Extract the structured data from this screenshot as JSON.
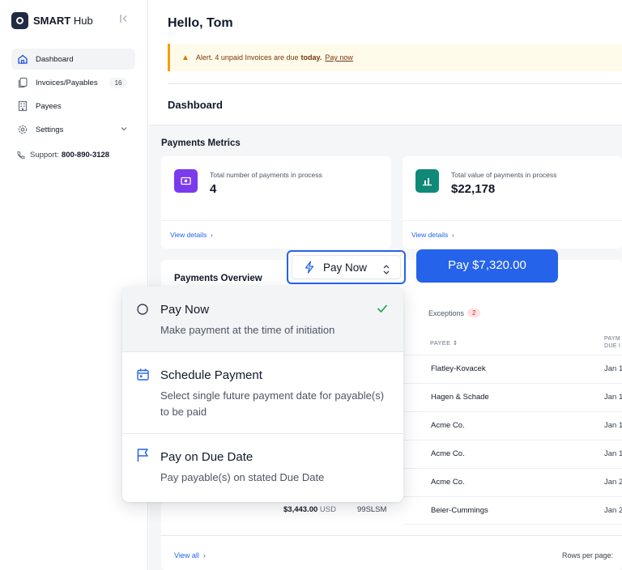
{
  "sidebar": {
    "brand_bold": "SMART",
    "brand_rest": "Hub",
    "items": [
      {
        "label": "Dashboard"
      },
      {
        "label": "Invoices/Payables",
        "badge": "16"
      },
      {
        "label": "Payees"
      },
      {
        "label": "Settings"
      }
    ],
    "support_label": "Support:",
    "support_phone": "800-890-3128"
  },
  "header": {
    "greeting": "Hello, Tom",
    "alert_text": "Alert. 4 unpaid Invoices are due",
    "alert_bold": "today.",
    "alert_link": "Pay now",
    "section_title": "Dashboard"
  },
  "metrics": {
    "title": "Payments Metrics",
    "cards": [
      {
        "label": "Total number of payments in process",
        "value": "4",
        "link": "View details",
        "color": "#7c3aed"
      },
      {
        "label": "Total value of payments in process",
        "value": "$22,178",
        "link": "View details",
        "color": "#0f8a78"
      }
    ]
  },
  "overview": {
    "title": "Payments Overview",
    "exceptions_label": "Exceptions",
    "exceptions_count": "2",
    "col_payee": "PAYEE",
    "col_payment_line1": "PAYM",
    "col_payment_line2": "DUE I",
    "rows": [
      {
        "payee": "Flatley-Kovacek",
        "date": "Jan 1"
      },
      {
        "payee": "Hagen & Schade",
        "date": "Jan 1"
      },
      {
        "payee": "Acme Co.",
        "date": "Jan 1"
      },
      {
        "payee": "Acme Co.",
        "date": "Jan 1"
      },
      {
        "payee": "Acme Co.",
        "date": "Jan 2"
      },
      {
        "payee": "Beier-Cummings",
        "date": "Jan 2",
        "amount": "$3,443.00",
        "currency": "USD",
        "ref": "99SLSM"
      }
    ],
    "view_all": "View all",
    "rows_per_page": "Rows per page:"
  },
  "payment": {
    "selected": "Pay Now",
    "button_label": "Pay $7,320.00",
    "accent": "#2563eb"
  },
  "dropdown": {
    "options": [
      {
        "title": "Pay Now",
        "desc": "Make payment at the time of initiation",
        "icon": "radio-circle-icon",
        "selected": true
      },
      {
        "title": "Schedule Payment",
        "desc": "Select single future payment date for payable(s) to be paid",
        "icon": "calendar-icon"
      },
      {
        "title": "Pay on Due Date",
        "desc": "Pay payable(s) on stated Due Date",
        "icon": "flag-icon"
      }
    ]
  }
}
